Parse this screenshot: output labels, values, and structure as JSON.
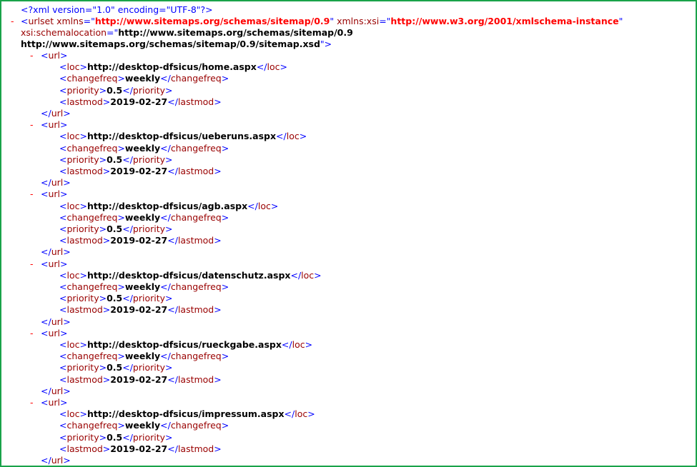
{
  "declaration": {
    "text": "<?xml version=\"1.0\" encoding=\"UTF-8\"?>"
  },
  "root": {
    "toggle": "-",
    "tag": "urlset",
    "attrs": [
      {
        "name": "xmlns",
        "value": "http://www.sitemaps.org/schemas/sitemap/0.9"
      },
      {
        "name": "xmlns:xsi",
        "value": "http://www.w3.org/2001/xmlschema-instance"
      },
      {
        "name": "xsi:schemalocation",
        "value_line1": "http://www.sitemaps.org/schemas/sitemap/0.9",
        "value_line2": "http://www.sitemaps.org/schemas/sitemap/0.9/sitemap.xsd"
      }
    ]
  },
  "url_tag": "url",
  "child_tags": {
    "loc": "loc",
    "changefreq": "changefreq",
    "priority": "priority",
    "lastmod": "lastmod"
  },
  "urls": [
    {
      "toggle": "-",
      "loc": "http://desktop-dfsicus/home.aspx",
      "changefreq": "weekly",
      "priority": "0.5",
      "lastmod": "2019-02-27"
    },
    {
      "toggle": "-",
      "loc": "http://desktop-dfsicus/ueberuns.aspx",
      "changefreq": "weekly",
      "priority": "0.5",
      "lastmod": "2019-02-27"
    },
    {
      "toggle": "-",
      "loc": "http://desktop-dfsicus/agb.aspx",
      "changefreq": "weekly",
      "priority": "0.5",
      "lastmod": "2019-02-27"
    },
    {
      "toggle": "-",
      "loc": "http://desktop-dfsicus/datenschutz.aspx",
      "changefreq": "weekly",
      "priority": "0.5",
      "lastmod": "2019-02-27"
    },
    {
      "toggle": "-",
      "loc": "http://desktop-dfsicus/rueckgabe.aspx",
      "changefreq": "weekly",
      "priority": "0.5",
      "lastmod": "2019-02-27"
    },
    {
      "toggle": "-",
      "loc": "http://desktop-dfsicus/impressum.aspx",
      "changefreq": "weekly",
      "priority": "0.5",
      "lastmod": "2019-02-27"
    }
  ],
  "colors": {
    "bracket": "#0000ff",
    "tag": "#990000",
    "attr_value": "#ff0000",
    "toggle": "#ff0000",
    "frame_border": "#19a34a"
  }
}
